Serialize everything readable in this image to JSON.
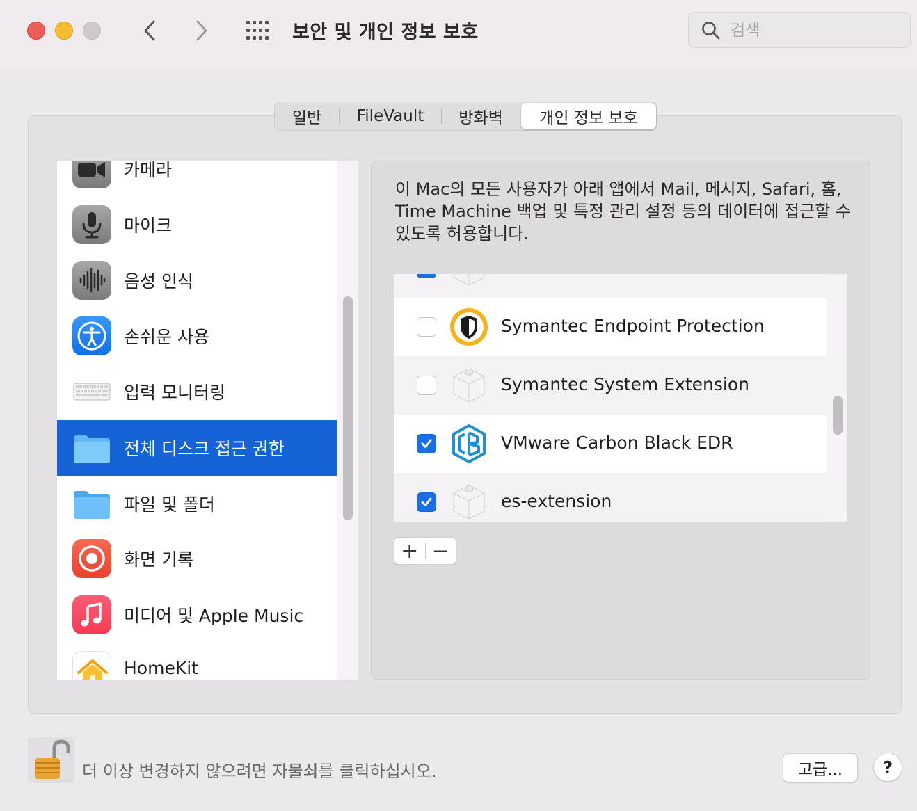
{
  "window": {
    "title": "보안 및 개인 정보 보호",
    "search_placeholder": "검색"
  },
  "tabs": [
    {
      "label": "일반"
    },
    {
      "label": "FileVault"
    },
    {
      "label": "방화벽"
    },
    {
      "label": "개인 정보 보호",
      "selected": true
    }
  ],
  "sidebar": {
    "items": [
      {
        "label": "카메라",
        "icon": "camera-icon"
      },
      {
        "label": "마이크",
        "icon": "microphone-icon"
      },
      {
        "label": "음성 인식",
        "icon": "speech-waveform-icon"
      },
      {
        "label": "손쉬운 사용",
        "icon": "accessibility-icon"
      },
      {
        "label": "입력 모니터링",
        "icon": "keyboard-icon"
      },
      {
        "label": "전체 디스크 접근 권한",
        "icon": "folder-icon",
        "selected": true
      },
      {
        "label": "파일 및 폴더",
        "icon": "folder-icon"
      },
      {
        "label": "화면 기록",
        "icon": "screen-record-icon"
      },
      {
        "label": "미디어 및 Apple Music",
        "icon": "music-note-icon"
      },
      {
        "label": "HomeKit",
        "icon": "home-icon"
      }
    ]
  },
  "main": {
    "description": "이 Mac의 모든 사용자가 아래 앱에서 Mail, 메시지, Safari, 홈, Time Machine 백업 및 특정 관리 설정 등의 데이터에 접근할 수 있도록 허용합니다.",
    "apps": [
      {
        "name": "Symantec Endpoint Protection",
        "checked": false,
        "icon": "symantec-shield-icon"
      },
      {
        "name": "Symantec System Extension",
        "checked": false,
        "icon": "system-extension-icon"
      },
      {
        "name": "VMware Carbon Black EDR",
        "checked": true,
        "icon": "carbon-black-icon"
      },
      {
        "name": "es-extension",
        "checked": true,
        "icon": "system-extension-icon"
      }
    ],
    "add_label": "+",
    "remove_label": "−"
  },
  "footer": {
    "lock_text": "더 이상 변경하지 않으려면 자물쇠를 클릭하십시오.",
    "advanced_label": "고급...",
    "help_label": "?"
  },
  "colors": {
    "accent": "#1563d6",
    "checkbox_on": "#1a6fe6"
  }
}
